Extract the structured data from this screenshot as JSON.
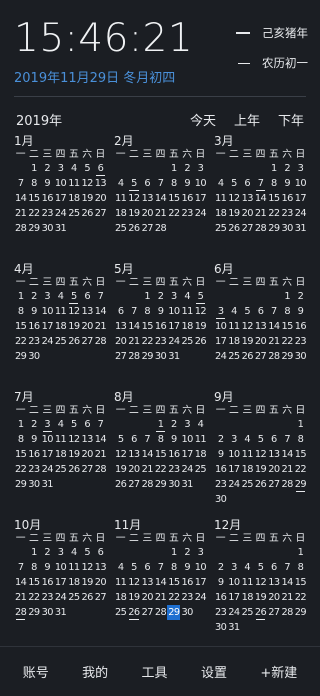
{
  "clock": "15:46:21",
  "lunar": {
    "year_label": "己亥猪年",
    "day_label": "农历初一"
  },
  "date_line": "2019年11月29日 冬月初四",
  "year_label": "2019年",
  "nav": {
    "today": "今天",
    "prev_year": "上年",
    "next_year": "下年"
  },
  "weekday_headers": [
    "一",
    "二",
    "三",
    "四",
    "五",
    "六",
    "日"
  ],
  "months": [
    {
      "name": "1月",
      "weeks": [
        [
          "",
          "1",
          "2",
          "3",
          "4",
          "5",
          "6"
        ],
        [
          "7",
          "8",
          "9",
          "10",
          "11",
          "12",
          "13"
        ],
        [
          "14",
          "15",
          "16",
          "17",
          "18",
          "19",
          "20"
        ],
        [
          "21",
          "22",
          "23",
          "24",
          "25",
          "26",
          "27"
        ],
        [
          "28",
          "29",
          "30",
          "31",
          "",
          "",
          ""
        ]
      ],
      "marked": [
        "6"
      ]
    },
    {
      "name": "2月",
      "weeks": [
        [
          "",
          "",
          "",
          "",
          "1",
          "2",
          "3"
        ],
        [
          "4",
          "5",
          "6",
          "7",
          "8",
          "9",
          "10"
        ],
        [
          "11",
          "12",
          "13",
          "14",
          "15",
          "16",
          "17"
        ],
        [
          "18",
          "19",
          "20",
          "21",
          "22",
          "23",
          "24"
        ],
        [
          "25",
          "26",
          "27",
          "28",
          "",
          "",
          ""
        ]
      ],
      "marked": [
        "5"
      ]
    },
    {
      "name": "3月",
      "weeks": [
        [
          "",
          "",
          "",
          "",
          "1",
          "2",
          "3"
        ],
        [
          "4",
          "5",
          "6",
          "7",
          "8",
          "9",
          "10"
        ],
        [
          "11",
          "12",
          "13",
          "14",
          "15",
          "16",
          "17"
        ],
        [
          "18",
          "19",
          "20",
          "21",
          "22",
          "23",
          "24"
        ],
        [
          "25",
          "26",
          "27",
          "28",
          "29",
          "30",
          "31"
        ]
      ],
      "marked": [
        "7"
      ]
    },
    {
      "name": "4月",
      "weeks": [
        [
          "1",
          "2",
          "3",
          "4",
          "5",
          "6",
          "7"
        ],
        [
          "8",
          "9",
          "10",
          "11",
          "12",
          "13",
          "14"
        ],
        [
          "15",
          "16",
          "17",
          "18",
          "19",
          "20",
          "21"
        ],
        [
          "22",
          "23",
          "24",
          "25",
          "26",
          "27",
          "28"
        ],
        [
          "29",
          "30",
          "",
          "",
          "",
          "",
          ""
        ]
      ],
      "marked": [
        "5"
      ]
    },
    {
      "name": "5月",
      "weeks": [
        [
          "",
          "",
          "1",
          "2",
          "3",
          "4",
          "5"
        ],
        [
          "6",
          "7",
          "8",
          "9",
          "10",
          "11",
          "12"
        ],
        [
          "13",
          "14",
          "15",
          "16",
          "17",
          "18",
          "19"
        ],
        [
          "20",
          "21",
          "22",
          "23",
          "24",
          "25",
          "26"
        ],
        [
          "27",
          "28",
          "29",
          "30",
          "31",
          "",
          ""
        ]
      ],
      "marked": [
        "5"
      ]
    },
    {
      "name": "6月",
      "weeks": [
        [
          "",
          "",
          "",
          "",
          "",
          "1",
          "2"
        ],
        [
          "3",
          "4",
          "5",
          "6",
          "7",
          "8",
          "9"
        ],
        [
          "10",
          "11",
          "12",
          "13",
          "14",
          "15",
          "16"
        ],
        [
          "17",
          "18",
          "19",
          "20",
          "21",
          "22",
          "23"
        ],
        [
          "24",
          "25",
          "26",
          "27",
          "28",
          "29",
          "30"
        ]
      ],
      "marked": [
        "3"
      ]
    },
    {
      "name": "7月",
      "weeks": [
        [
          "1",
          "2",
          "3",
          "4",
          "5",
          "6",
          "7"
        ],
        [
          "8",
          "9",
          "10",
          "11",
          "12",
          "13",
          "14"
        ],
        [
          "15",
          "16",
          "17",
          "18",
          "19",
          "20",
          "21"
        ],
        [
          "22",
          "23",
          "24",
          "25",
          "26",
          "27",
          "28"
        ],
        [
          "29",
          "30",
          "31",
          "",
          "",
          "",
          ""
        ]
      ],
      "marked": [
        "3"
      ]
    },
    {
      "name": "8月",
      "weeks": [
        [
          "",
          "",
          "",
          "1",
          "2",
          "3",
          "4"
        ],
        [
          "5",
          "6",
          "7",
          "8",
          "9",
          "10",
          "11"
        ],
        [
          "12",
          "13",
          "14",
          "15",
          "16",
          "17",
          "18"
        ],
        [
          "19",
          "20",
          "21",
          "22",
          "23",
          "24",
          "25"
        ],
        [
          "26",
          "27",
          "28",
          "29",
          "30",
          "31",
          ""
        ]
      ],
      "marked": [
        "1"
      ]
    },
    {
      "name": "9月",
      "weeks": [
        [
          "",
          "",
          "",
          "",
          "",
          "",
          "1"
        ],
        [
          "2",
          "3",
          "4",
          "5",
          "6",
          "7",
          "8"
        ],
        [
          "9",
          "10",
          "11",
          "12",
          "13",
          "14",
          "15"
        ],
        [
          "16",
          "17",
          "18",
          "19",
          "20",
          "21",
          "22"
        ],
        [
          "23",
          "24",
          "25",
          "26",
          "27",
          "28",
          "29"
        ],
        [
          "30",
          "",
          "",
          "",
          "",
          "",
          ""
        ]
      ],
      "marked": [
        "29"
      ]
    },
    {
      "name": "10月",
      "weeks": [
        [
          "",
          "1",
          "2",
          "3",
          "4",
          "5",
          "6"
        ],
        [
          "7",
          "8",
          "9",
          "10",
          "11",
          "12",
          "13"
        ],
        [
          "14",
          "15",
          "16",
          "17",
          "18",
          "19",
          "20"
        ],
        [
          "21",
          "22",
          "23",
          "24",
          "25",
          "26",
          "27"
        ],
        [
          "28",
          "29",
          "30",
          "31",
          "",
          "",
          ""
        ]
      ],
      "marked": [
        "28"
      ]
    },
    {
      "name": "11月",
      "weeks": [
        [
          "",
          "",
          "",
          "",
          "1",
          "2",
          "3"
        ],
        [
          "4",
          "5",
          "6",
          "7",
          "8",
          "9",
          "10"
        ],
        [
          "11",
          "12",
          "13",
          "14",
          "15",
          "16",
          "17"
        ],
        [
          "18",
          "19",
          "20",
          "21",
          "22",
          "23",
          "24"
        ],
        [
          "25",
          "26",
          "27",
          "28",
          "29",
          "30",
          ""
        ]
      ],
      "marked": [
        "26"
      ],
      "today": "29"
    },
    {
      "name": "12月",
      "weeks": [
        [
          "",
          "",
          "",
          "",
          "",
          "",
          "1"
        ],
        [
          "2",
          "3",
          "4",
          "5",
          "6",
          "7",
          "8"
        ],
        [
          "9",
          "10",
          "11",
          "12",
          "13",
          "14",
          "15"
        ],
        [
          "16",
          "17",
          "18",
          "19",
          "20",
          "21",
          "22"
        ],
        [
          "23",
          "24",
          "25",
          "26",
          "27",
          "28",
          "29"
        ],
        [
          "30",
          "31",
          "",
          "",
          "",
          "",
          ""
        ]
      ],
      "marked": [
        "26"
      ]
    }
  ],
  "bottom_nav": [
    "账号",
    "我的",
    "工具",
    "设置",
    "+新建"
  ],
  "colors": {
    "background": "#1b1e23",
    "accent": "#1e6fd0",
    "date_text": "#4a90d9",
    "text": "#e7e9ec"
  }
}
